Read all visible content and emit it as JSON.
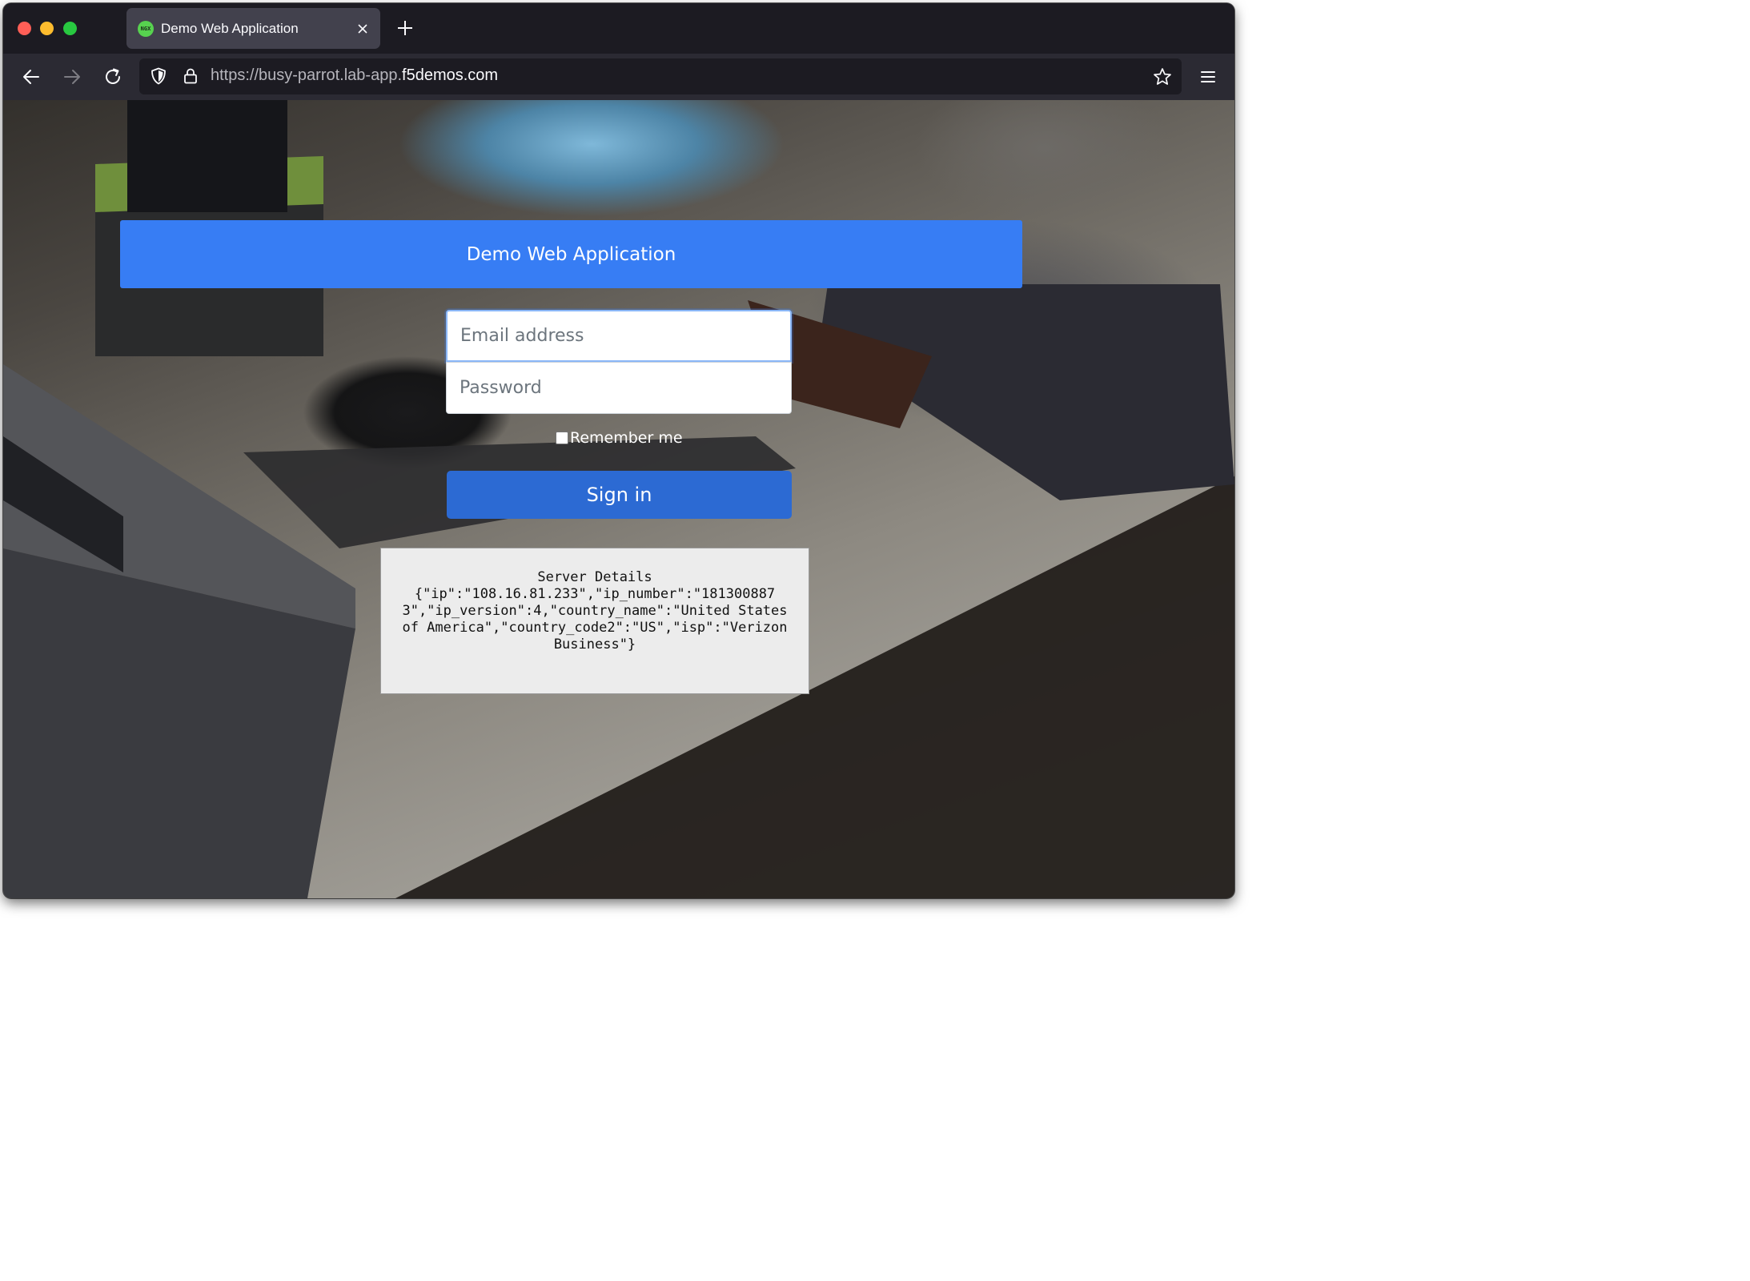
{
  "browser": {
    "tab": {
      "title": "Demo Web Application",
      "favicon_icon": "nginx-logo-icon"
    },
    "address_bar": {
      "url_prefix": "https://busy-parrot.lab-app.",
      "url_domain": "f5demos.com"
    },
    "icons": {
      "back": "arrow-left-icon",
      "forward": "arrow-right-icon",
      "reload": "reload-icon",
      "shield": "shield-icon",
      "lock": "lock-icon",
      "bookmark": "star-icon",
      "menu": "hamburger-menu-icon",
      "close_tab": "close-icon",
      "new_tab": "plus-icon"
    }
  },
  "page": {
    "header_title": "Demo Web Application",
    "login": {
      "email_placeholder": "Email address",
      "password_placeholder": "Password",
      "remember_label": "Remember me",
      "remember_checked": false,
      "submit_label": "Sign in"
    },
    "server_details": {
      "title": "Server Details",
      "json_text": "{\"ip\":\"108.16.81.233\",\"ip_number\":\"1813008873\",\"ip_version\":4,\"country_name\":\"United States of America\",\"country_code2\":\"US\",\"isp\":\"Verizon Business\"}"
    }
  },
  "colors": {
    "header_bg": "#377df4",
    "signin_bg": "#2c6ad3",
    "server_box_bg": "#ececec",
    "browser_chrome": "#1c1b22",
    "tab_active": "#42414d"
  }
}
